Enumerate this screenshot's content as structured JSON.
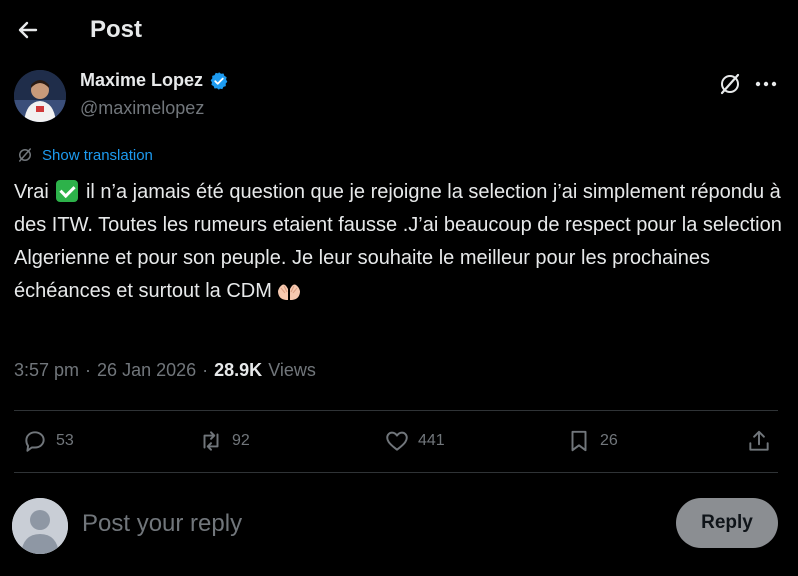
{
  "header": {
    "title": "Post",
    "back_icon": "arrow-left-icon"
  },
  "author": {
    "name": "Maxime Lopez",
    "handle": "@maximelopez",
    "verified_color": "#1d9bf0"
  },
  "translate": {
    "label": "Show translation"
  },
  "tweet": {
    "part1": "Vrai",
    "part2": " il n’a jamais été question que je rejoigne la selection j’ai simplement répondu à des ITW. Toutes les rumeurs etaient fausse .J’ai beaucoup de respect pour la selection Algerienne et pour son peuple. Je leur souhaite le meilleur pour les prochaines échéances et surtout la CDM",
    "emoji_1": "check-mark-button-emoji",
    "emoji_2": "palms-up-together-emoji"
  },
  "meta": {
    "time": "3:57 pm",
    "date": "26 Jan 2026",
    "views_count": "28.9K",
    "views_label": "Views",
    "separator": "·"
  },
  "actions": {
    "replies": "53",
    "reposts": "92",
    "likes": "441",
    "bookmarks": "26"
  },
  "reply": {
    "placeholder": "Post your reply",
    "button_label": "Reply"
  },
  "colors": {
    "background": "#000000",
    "text": "#e7e9ea",
    "secondary": "#71767b",
    "accent": "#1d9bf0",
    "divider": "#2f3336"
  }
}
